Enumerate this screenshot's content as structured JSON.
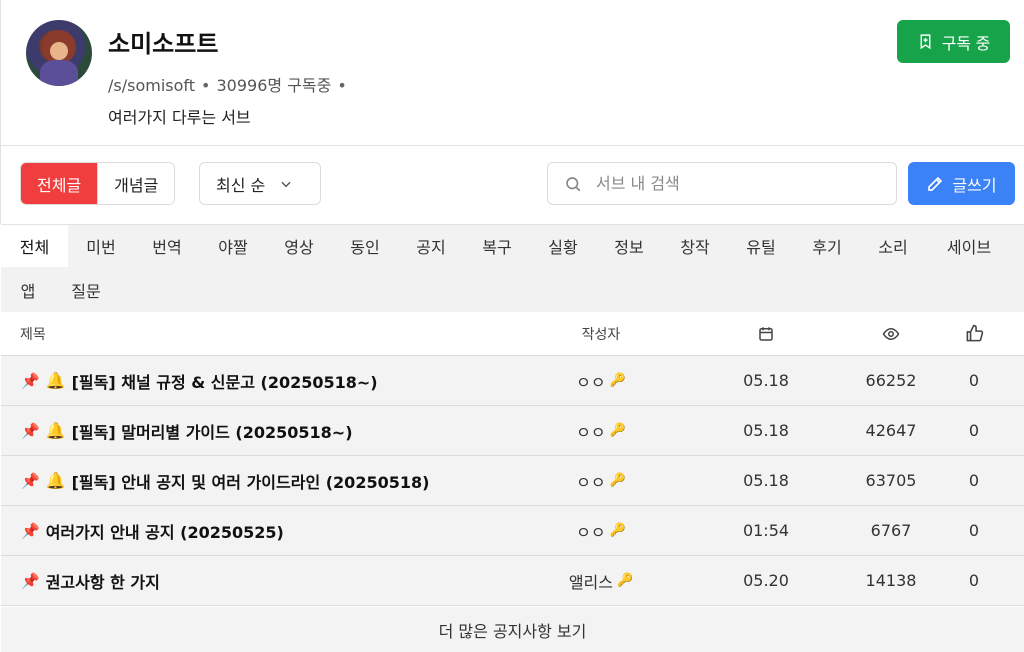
{
  "channel": {
    "name": "소미소프트",
    "slug": "/s/somisoft",
    "subscribers": "30996명 구독중",
    "description": "여러가지 다루는 서브",
    "subscribe_label": "구독 중"
  },
  "toolbar": {
    "filter_all": "전체글",
    "filter_concept": "개념글",
    "sort_label": "최신 순",
    "search_placeholder": "서브 내 검색",
    "write_label": "글쓰기"
  },
  "categories": [
    "전체",
    "미번",
    "번역",
    "야짤",
    "영상",
    "동인",
    "공지",
    "복구",
    "실황",
    "정보",
    "창작",
    "유틸",
    "후기",
    "소리",
    "세이브",
    "앱",
    "질문"
  ],
  "table": {
    "header_title": "제목",
    "header_author": "작성자",
    "rows": [
      {
        "title": "[필독] 채널 규정 & 신문고 (20250518~)",
        "author": "ㅇㅇ",
        "date": "05.18",
        "views": "66252",
        "likes": "0"
      },
      {
        "title": "[필독] 말머리별 가이드 (20250518~)",
        "author": "ㅇㅇ",
        "date": "05.18",
        "views": "42647",
        "likes": "0"
      },
      {
        "title": "[필독] 안내 공지 및 여러 가이드라인 (20250518)",
        "author": "ㅇㅇ",
        "date": "05.18",
        "views": "63705",
        "likes": "0"
      },
      {
        "title": "여러가지 안내 공지 (20250525)",
        "author": "ㅇㅇ",
        "date": "01:54",
        "views": "6767",
        "likes": "0"
      },
      {
        "title": "권고사항 한 가지",
        "author": "앨리스",
        "date": "05.20",
        "views": "14138",
        "likes": "0"
      }
    ],
    "more_label": "더 많은 공지사항 보기"
  },
  "colors": {
    "subscribe": "#16a34a",
    "filter_active": "#f03e3e",
    "write": "#3b82f6",
    "manager_key": "#f08c2a"
  }
}
